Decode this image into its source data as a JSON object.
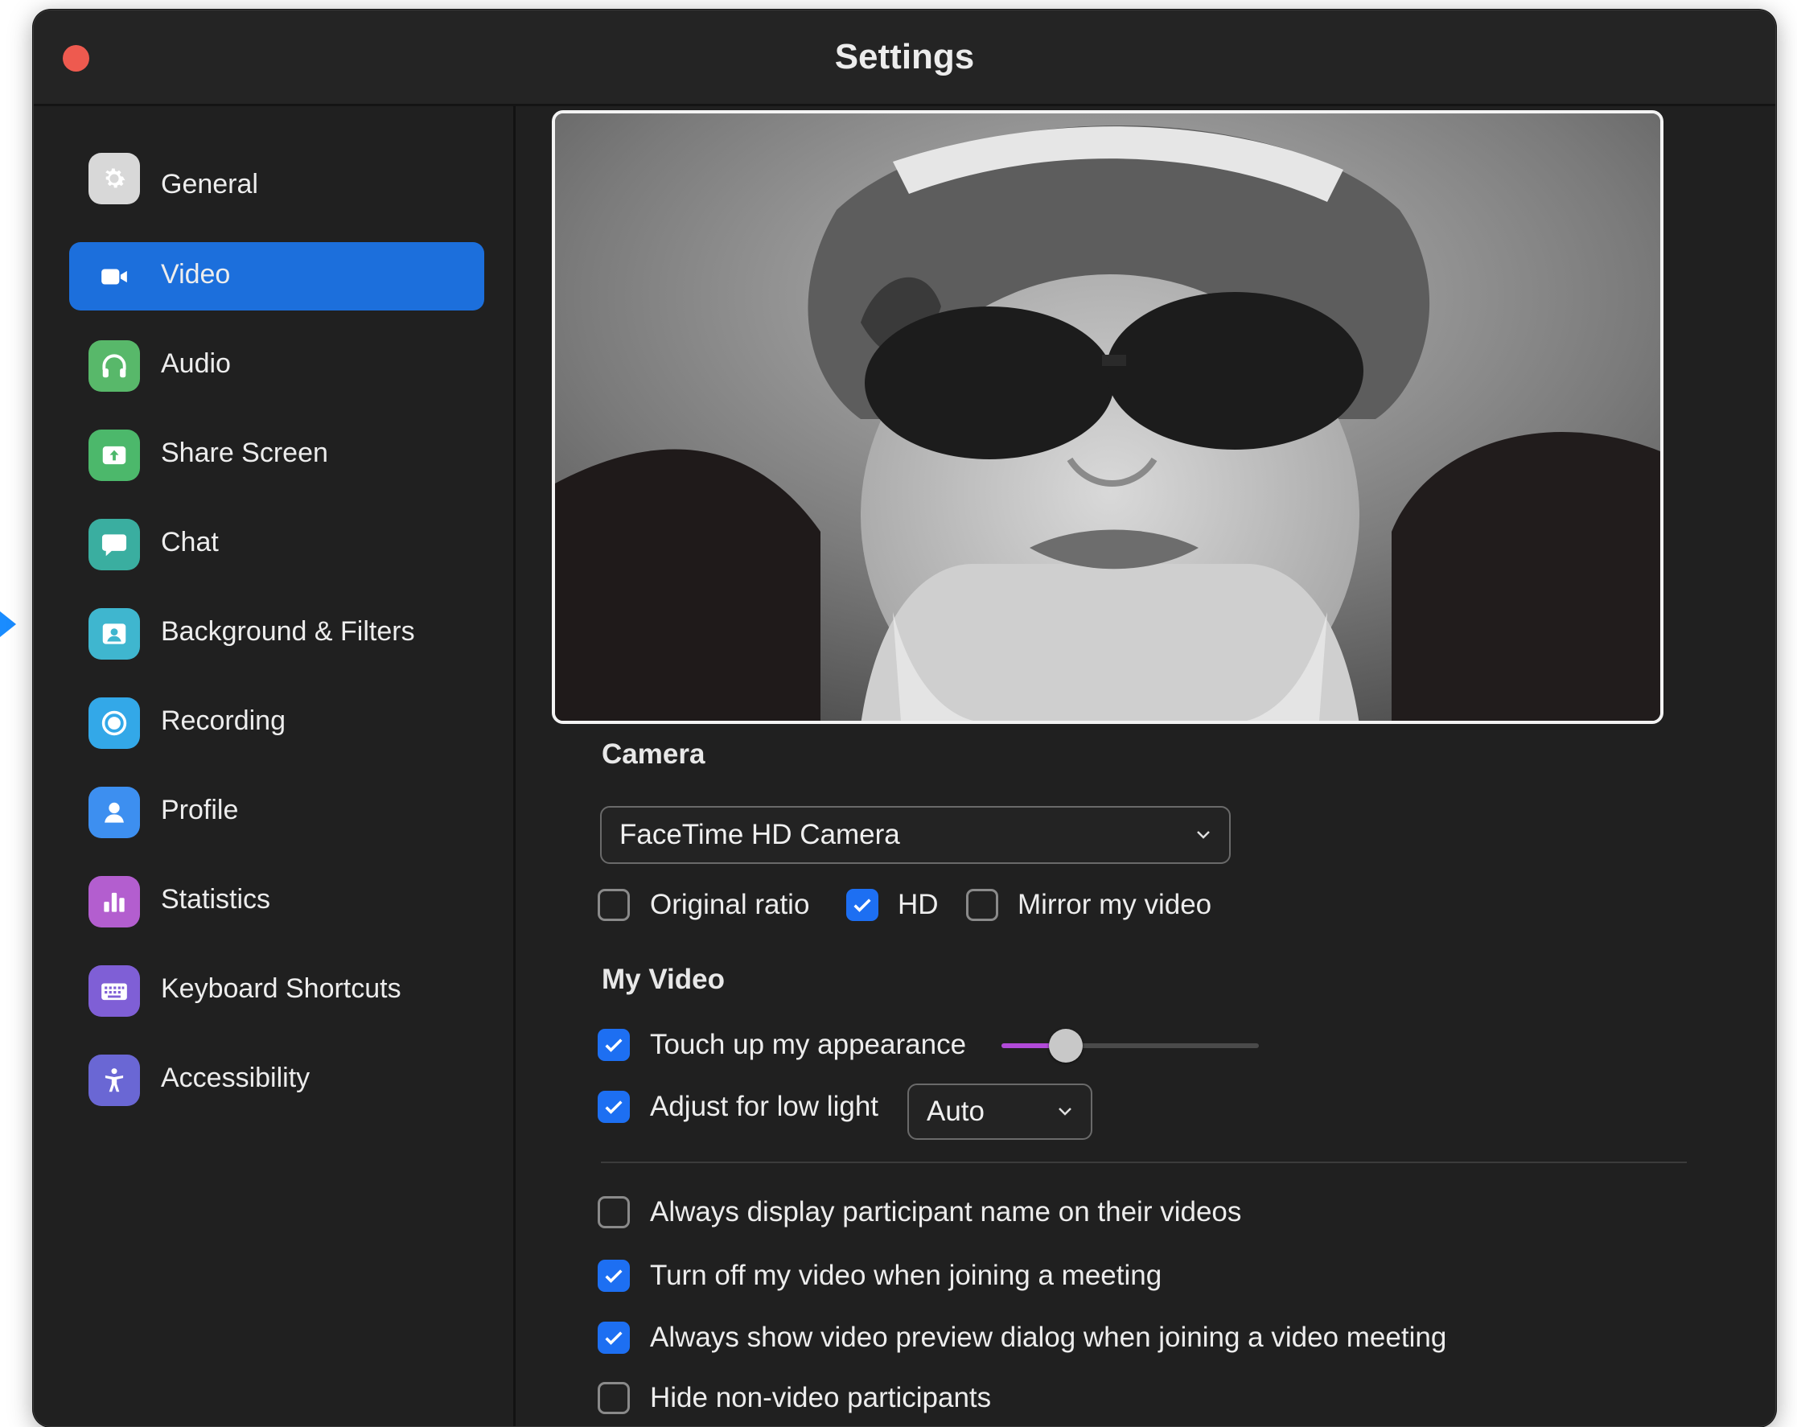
{
  "window": {
    "title": "Settings"
  },
  "sidebar": {
    "items": [
      {
        "label": "General",
        "icon": "gear-icon",
        "color": "#d8d8d8",
        "active": false
      },
      {
        "label": "Video",
        "icon": "video-camera-icon",
        "color": "#1c6fdc",
        "active": true
      },
      {
        "label": "Audio",
        "icon": "headphones-icon",
        "color": "#58b86a",
        "active": false
      },
      {
        "label": "Share Screen",
        "icon": "share-screen-icon",
        "color": "#4cb86b",
        "active": false
      },
      {
        "label": "Chat",
        "icon": "chat-bubble-icon",
        "color": "#3aaea0",
        "active": false
      },
      {
        "label": "Background & Filters",
        "icon": "background-icon",
        "color": "#3fb6cf",
        "active": false
      },
      {
        "label": "Recording",
        "icon": "record-icon",
        "color": "#33a8e8",
        "active": false
      },
      {
        "label": "Profile",
        "icon": "profile-icon",
        "color": "#3d8ff0",
        "active": false
      },
      {
        "label": "Statistics",
        "icon": "bar-chart-icon",
        "color": "#b35ecf",
        "active": false
      },
      {
        "label": "Keyboard Shortcuts",
        "icon": "keyboard-icon",
        "color": "#7f5fd6",
        "active": false
      },
      {
        "label": "Accessibility",
        "icon": "accessibility-icon",
        "color": "#6a67d4",
        "active": false
      }
    ]
  },
  "camera": {
    "section_title": "Camera",
    "selected": "FaceTime HD Camera",
    "options": [
      {
        "label": "Original ratio",
        "checked": false
      },
      {
        "label": "HD",
        "checked": true
      },
      {
        "label": "Mirror my video",
        "checked": false
      }
    ]
  },
  "my_video": {
    "section_title": "My Video",
    "touch_up": {
      "label": "Touch up my appearance",
      "checked": true,
      "level": 0.25
    },
    "low_light": {
      "label": "Adjust for low light",
      "checked": true,
      "mode": "Auto"
    }
  },
  "options": [
    {
      "label": "Always display participant name on their videos",
      "checked": false
    },
    {
      "label": "Turn off my video when joining a meeting",
      "checked": true
    },
    {
      "label": "Always show video preview dialog when joining a video meeting",
      "checked": true
    },
    {
      "label": "Hide non-video participants",
      "checked": false
    }
  ],
  "colors": {
    "accent": "#1d6ff2",
    "slider": "#b14ad8",
    "window_bg": "#202020"
  }
}
